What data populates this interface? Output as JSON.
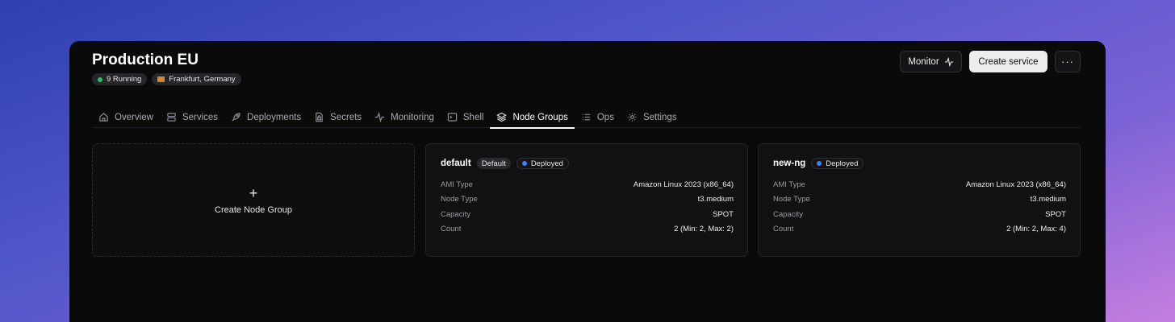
{
  "header": {
    "title": "Production EU",
    "running_badge": "9 Running",
    "region_badge": "Frankfurt, Germany"
  },
  "actions": {
    "monitor_label": "Monitor",
    "create_label": "Create service",
    "more_label": "···"
  },
  "tabs": [
    {
      "label": "Overview",
      "icon": "home-icon"
    },
    {
      "label": "Services",
      "icon": "server-icon"
    },
    {
      "label": "Deployments",
      "icon": "rocket-icon"
    },
    {
      "label": "Secrets",
      "icon": "file-lock-icon"
    },
    {
      "label": "Monitoring",
      "icon": "activity-icon"
    },
    {
      "label": "Shell",
      "icon": "terminal-icon"
    },
    {
      "label": "Node Groups",
      "icon": "layers-icon",
      "active": true
    },
    {
      "label": "Ops",
      "icon": "list-icon"
    },
    {
      "label": "Settings",
      "icon": "gear-icon"
    }
  ],
  "create_card": {
    "plus": "+",
    "label": "Create Node Group"
  },
  "node_groups": [
    {
      "name": "default",
      "default_badge": "Default",
      "status": "Deployed",
      "rows": [
        {
          "key": "AMI Type",
          "value": "Amazon Linux 2023 (x86_64)"
        },
        {
          "key": "Node Type",
          "value": "t3.medium"
        },
        {
          "key": "Capacity",
          "value": "SPOT"
        },
        {
          "key": "Count",
          "value": "2 (Min: 2, Max: 2)"
        }
      ]
    },
    {
      "name": "new-ng",
      "status": "Deployed",
      "rows": [
        {
          "key": "AMI Type",
          "value": "Amazon Linux 2023 (x86_64)"
        },
        {
          "key": "Node Type",
          "value": "t3.medium"
        },
        {
          "key": "Capacity",
          "value": "SPOT"
        },
        {
          "key": "Count",
          "value": "2 (Min: 2, Max: 4)"
        }
      ]
    }
  ],
  "colors": {
    "status_running": "#22c55e",
    "status_deployed": "#3b82f6",
    "annotation_arrow": "#1a7cf0"
  }
}
